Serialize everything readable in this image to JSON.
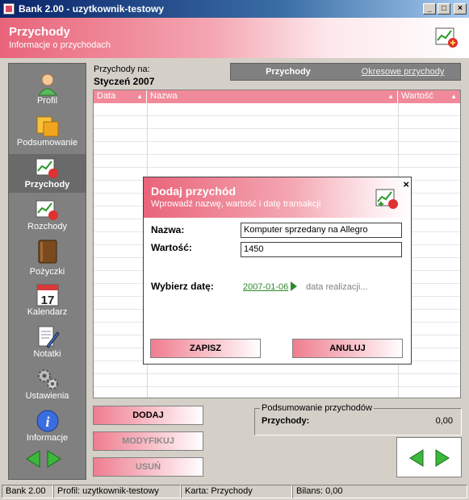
{
  "window": {
    "title": "Bank 2.00 - uzytkownik-testowy",
    "btn_min": "_",
    "btn_max": "□",
    "btn_close": "×"
  },
  "header": {
    "title": "Przychody",
    "subtitle": "Informacje o przychodach"
  },
  "sidebar": {
    "items": [
      {
        "label": "Profil",
        "icon": "user-icon"
      },
      {
        "label": "Podsumowanie",
        "icon": "summary-icon"
      },
      {
        "label": "Przychody",
        "icon": "income-chart-icon",
        "active": true
      },
      {
        "label": "Rozchody",
        "icon": "expense-chart-icon"
      },
      {
        "label": "Pożyczki",
        "icon": "book-icon"
      },
      {
        "label": "Kalendarz",
        "icon": "calendar-icon",
        "calendar_day": "17"
      },
      {
        "label": "Notatki",
        "icon": "notes-icon"
      },
      {
        "label": "Ustawienia",
        "icon": "gears-icon"
      },
      {
        "label": "Informacje",
        "icon": "info-icon"
      }
    ]
  },
  "main": {
    "period_label": "Przychody na:",
    "period_value": "Styczeń 2007",
    "tabs": {
      "active": "Przychody",
      "other": "Okresowe przychody"
    },
    "table": {
      "columns": [
        "Data",
        "Nazwa",
        "Wartość"
      ],
      "rows": []
    },
    "buttons": {
      "add": "DODAJ",
      "modify": "MODYFIKUJ",
      "delete": "USUŃ"
    },
    "summary": {
      "legend": "Podsumowanie przychodów",
      "label": "Przychody:",
      "value": "0,00"
    }
  },
  "statusbar": {
    "app": "Bank 2.00",
    "profile": "Profil: uzytkownik-testowy",
    "card": "Karta: Przychody",
    "balance": "Bilans: 0,00"
  },
  "dialog": {
    "title": "Dodaj przychód",
    "subtitle": "Wprowadź nazwę, wartość i datę transakcji",
    "close": "×",
    "name_label": "Nazwa:",
    "name_value": "Komputer sprzedany na Allegro",
    "value_label": "Wartość:",
    "value_value": "1450",
    "date_label": "Wybierz datę:",
    "date_value": "2007-01-06",
    "date_hint": "data realizacji...",
    "save": "ZAPISZ",
    "cancel": "ANULUJ"
  },
  "colors": {
    "accent": "#e9647a",
    "grid_header": "#f08a9a",
    "sidebar": "#808080",
    "date_link": "#2d8a2d"
  }
}
